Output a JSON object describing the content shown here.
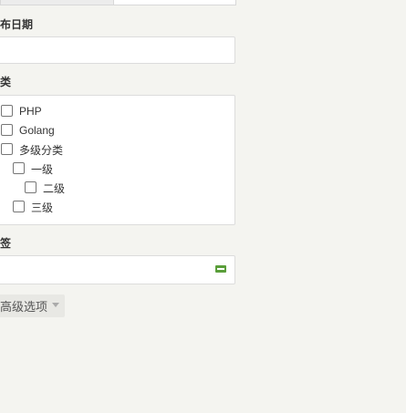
{
  "form": {
    "publish_date_label": "布日期",
    "category_label": "类",
    "tags_label": "签",
    "categories": [
      {
        "label": "PHP",
        "checked": false
      },
      {
        "label": "Golang",
        "checked": false
      },
      {
        "label": "多级分类",
        "checked": false
      },
      {
        "label": "一级",
        "checked": false
      },
      {
        "label": "二级",
        "checked": false
      },
      {
        "label": "三级",
        "checked": false
      }
    ],
    "advanced_label": "高级选项",
    "tag_icon": "tag-icon"
  },
  "colors": {
    "background": "#f4f4f0",
    "tag_icon": "#5a9e3a"
  }
}
